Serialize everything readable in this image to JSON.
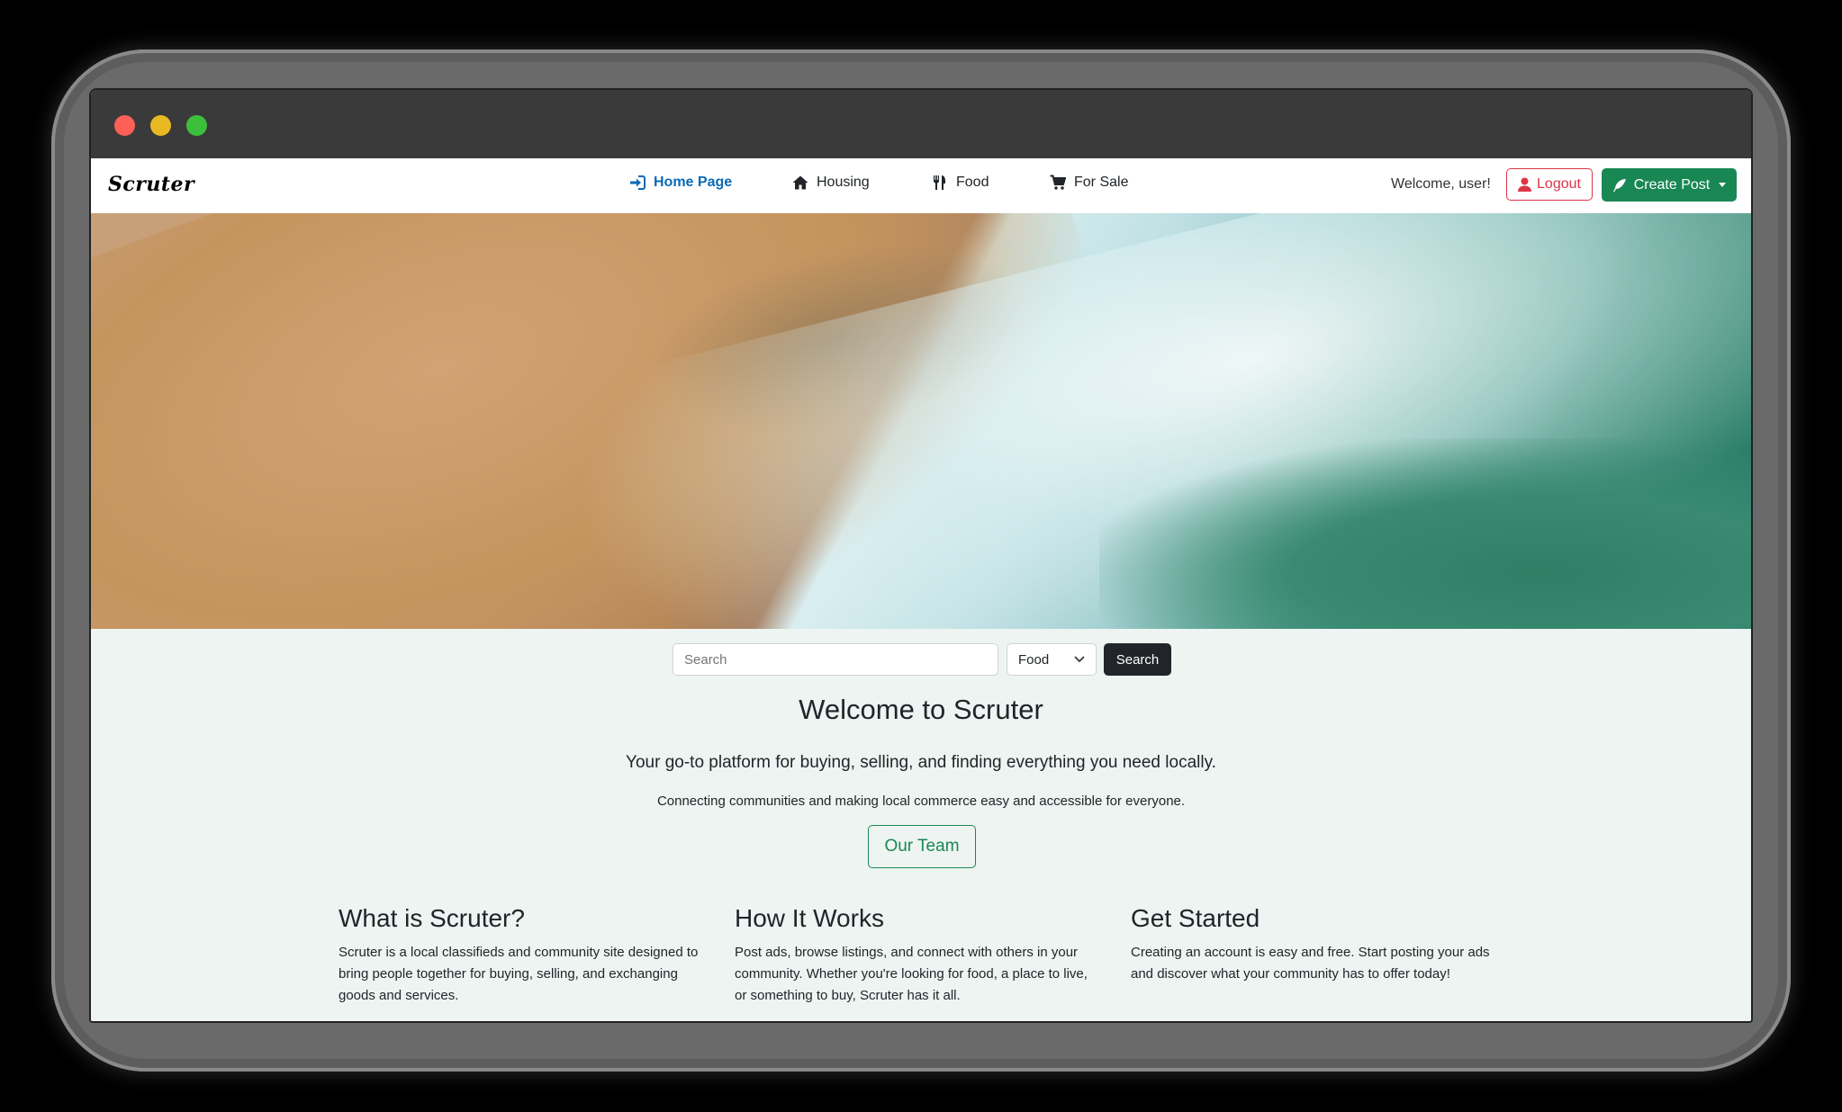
{
  "window": {
    "controls": [
      "close",
      "minimize",
      "maximize"
    ]
  },
  "navbar": {
    "brand": "Scruter",
    "items": [
      {
        "label": "Home Page",
        "icon": "sign-in-icon",
        "active": true
      },
      {
        "label": "Housing",
        "icon": "home-icon",
        "active": false
      },
      {
        "label": "Food",
        "icon": "utensils-icon",
        "active": false
      },
      {
        "label": "For Sale",
        "icon": "cart-icon",
        "active": false
      }
    ],
    "welcome": "Welcome, user!",
    "logout_label": "Logout",
    "create_label": "Create Post"
  },
  "hero": {
    "image": "aerial beach with waves"
  },
  "search": {
    "placeholder": "Search",
    "category_selected": "Food",
    "button_label": "Search"
  },
  "intro": {
    "title": "Welcome to Scruter",
    "lead": "Your go-to platform for buying, selling, and finding everything you need locally.",
    "sub": "Connecting communities and making local commerce easy and accessible for everyone.",
    "team_button": "Our Team"
  },
  "features": [
    {
      "title": "What is Scruter?",
      "text": "Scruter is a local classifieds and community site designed to bring people together for buying, selling, and exchanging goods and services."
    },
    {
      "title": "How It Works",
      "text": "Post ads, browse listings, and connect with others in your community. Whether you're looking for food, a place to live, or something to buy, Scruter has it all."
    },
    {
      "title": "Get Started",
      "text": "Creating an account is easy and free. Start posting your ads and discover what your community has to offer today!"
    }
  ],
  "colors": {
    "primary_active": "#0a6ab6",
    "success": "#198754",
    "danger": "#dc3545",
    "dark": "#212529",
    "content_bg": "#eef4f2"
  }
}
